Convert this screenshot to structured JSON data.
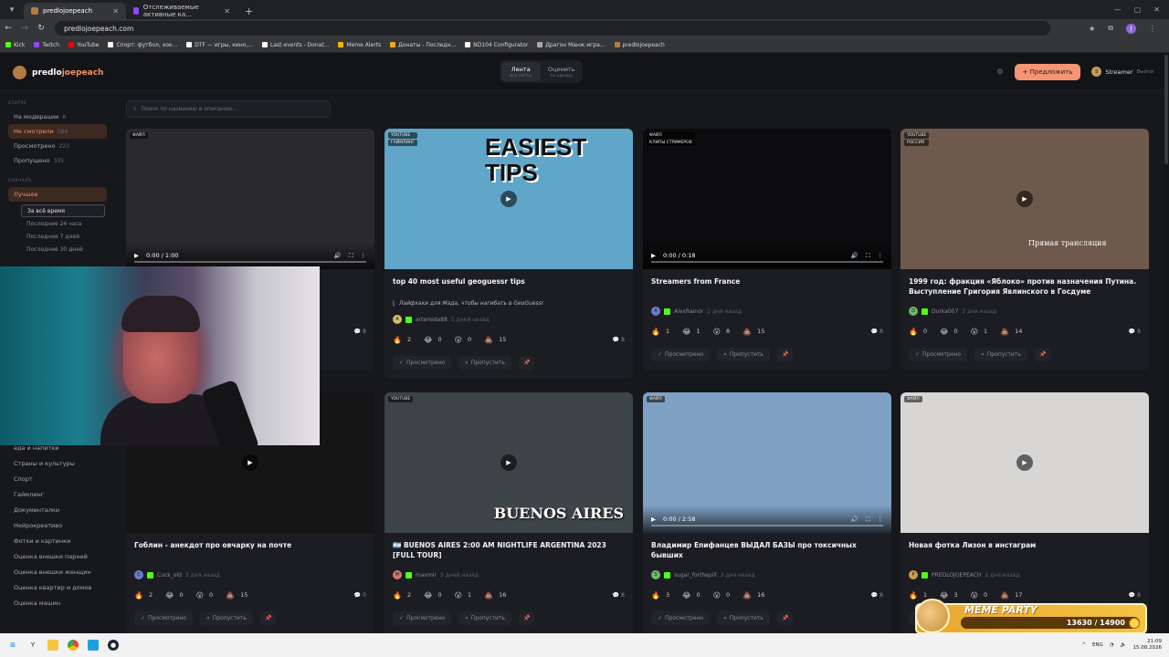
{
  "browser": {
    "tabs": [
      {
        "title": "predlojoepeach",
        "active": true,
        "favicon_color": "#b47a46"
      },
      {
        "title": "Отслеживаемые активные ка...",
        "active": false,
        "favicon_color": "#9146ff"
      }
    ],
    "new_tab": "+",
    "url": "predlojoepeach.com",
    "profile_letter": "J",
    "bookmarks": [
      {
        "label": "Kick",
        "color": "#53fc18"
      },
      {
        "label": "Twitch",
        "color": "#9146ff"
      },
      {
        "label": "YouTube",
        "color": "#ff0000"
      },
      {
        "label": "Спорт: футбол, хок...",
        "color": "#ffffff"
      },
      {
        "label": "DTF — игры, кино,...",
        "color": "#ffffff"
      },
      {
        "label": "Last events - Donat...",
        "color": "#ffffff"
      },
      {
        "label": "Meme Alerts",
        "color": "#f5b400"
      },
      {
        "label": "Донаты - Последн...",
        "color": "#f5a623"
      },
      {
        "label": "ND104 Configurator",
        "color": "#ffffff"
      },
      {
        "label": "Драгон Манж игра...",
        "color": "#aaaaaa"
      },
      {
        "label": "predlojoepeach",
        "color": "#b47a46"
      }
    ]
  },
  "site": {
    "logo_prefix": "predlo",
    "logo_accent": "joepeach",
    "view_tabs": [
      {
        "title": "Лента",
        "sub": "все посты",
        "active": true
      },
      {
        "title": "Оценить",
        "sub": "по одному",
        "active": false
      }
    ],
    "propose_label": "+ Предложить",
    "user_name": "Streamer",
    "user_initial": "S",
    "logout_label": "Выйти",
    "search_placeholder": "Поиск по названию и описанию..."
  },
  "sidebar": {
    "status_title": "СТАТУС",
    "status_items": [
      {
        "label": "На модерации",
        "count": "8",
        "active": false
      },
      {
        "label": "Не смотрели",
        "count": "584",
        "active": true
      },
      {
        "label": "Просмотрено",
        "count": "223",
        "active": false
      },
      {
        "label": "Пропущено",
        "count": "335",
        "active": false
      }
    ],
    "sort_title": "СНАЧАЛА",
    "sort_items": [
      {
        "label": "Лучшее",
        "active": true
      }
    ],
    "period_items": [
      {
        "label": "За всё время",
        "active": true
      },
      {
        "label": "Последние 24 часа",
        "active": false
      },
      {
        "label": "Последние 7 дней",
        "active": false
      },
      {
        "label": "Последние 30 дней",
        "active": false
      }
    ],
    "categories": [
      "еда и напитки",
      "Страны и культуры",
      "Спорт",
      "Гаймлинг",
      "Документалки",
      "Нейрокреативо",
      "Фотки и картинки",
      "Оценка внешки парней",
      "Оценка внешки женщин",
      "Оценка квартир и домов",
      "Оценка машин"
    ]
  },
  "cards": [
    {
      "tags": [
        "файл"
      ],
      "title": "",
      "desc": "",
      "author": "",
      "author_initial": "",
      "author_color": "#6c7bd0",
      "date": "",
      "time": "0:00 / 1:00",
      "has_controls": true,
      "reactions": [
        "",
        "",
        "",
        ""
      ],
      "comments": "8",
      "thumb_bg": "#2a2a2e"
    },
    {
      "tags": [
        "youtube",
        "гаймлинг"
      ],
      "title": "top 40 most useful geoguessr tips",
      "desc": "Лайфхаки для Мада, чтобы нагибать в GeoGuessr",
      "author": "artemida88",
      "author_initial": "A",
      "author_color": "#c9c26a",
      "date": "5 дней назад",
      "time": "",
      "has_controls": false,
      "reactions": [
        "2",
        "0",
        "0",
        "15"
      ],
      "comments": "8",
      "thumb_bg": "#5fa6c9",
      "thumb_text": "EASIEST TIPS"
    },
    {
      "tags": [
        "файл",
        "клипы стримеров"
      ],
      "title": "Streamers from France",
      "desc": "",
      "author": "AlexRainor",
      "author_initial": "A",
      "author_color": "#6c7bd0",
      "date": "2 дня назад",
      "time": "0:00 / 0:18",
      "has_controls": true,
      "reactions": [
        "1",
        "1",
        "8",
        "15"
      ],
      "comments": "8",
      "thumb_bg": "#0c0c0e"
    },
    {
      "tags": [
        "youtube",
        "россия"
      ],
      "title": "1999 год: фракция «Яблоко» против назначения Путина. Выступление Григория Явлинского в Госдуме",
      "desc": "",
      "author": "Durka007",
      "author_initial": "D",
      "author_color": "#6cb96c",
      "date": "2 дня назад",
      "time": "",
      "has_controls": false,
      "reactions": [
        "0",
        "0",
        "1",
        "14"
      ],
      "comments": "8",
      "thumb_bg": "#6e5a4c",
      "thumb_text": "Прямая трансляция"
    },
    {
      "tags": [],
      "title": "Гоблин - анекдот про овчарку на почте",
      "desc": "",
      "author": "Cuck_old",
      "author_initial": "C",
      "author_color": "#6c7bd0",
      "date": "3 дня назад",
      "time": "",
      "has_controls": false,
      "reactions": [
        "2",
        "0",
        "0",
        "15"
      ],
      "comments": "0",
      "thumb_bg": "#151515"
    },
    {
      "tags": [
        "youtube"
      ],
      "title": "🇦🇷 BUENOS AIRES 2:00 AM NIGHTLIFE ARGENTINA 2023 [FULL TOUR]",
      "desc": "",
      "author": "maxmir",
      "author_initial": "M",
      "author_color": "#d07a6c",
      "date": "5 дней назад",
      "time": "",
      "has_controls": false,
      "reactions": [
        "2",
        "0",
        "1",
        "16"
      ],
      "comments": "8",
      "thumb_bg": "#3e4548",
      "thumb_text": "BUENOS AIRES"
    },
    {
      "tags": [
        "файл"
      ],
      "title": "Владимир Епифанцев ВЫДАЛ БАЗЫ про токсичных бывших",
      "desc": "",
      "author": "sugar_forthepill",
      "author_initial": "S",
      "author_color": "#6cb96c",
      "date": "3 дня назад",
      "time": "0:00 / 2:58",
      "has_controls": true,
      "reactions": [
        "3",
        "0",
        "0",
        "16"
      ],
      "comments": "8",
      "thumb_bg": "#7ea0c2"
    },
    {
      "tags": [
        "файл"
      ],
      "title": "Новая фотка Лизон в инстаграм",
      "desc": "",
      "author": "PREDLOJOEPEACH",
      "author_initial": "P",
      "author_color": "#c9a04a",
      "date": "2 дня назад",
      "time": "",
      "has_controls": false,
      "reactions": [
        "1",
        "3",
        "0",
        "17"
      ],
      "comments": "8",
      "thumb_bg": "#d8d6d4"
    }
  ],
  "card_actions": {
    "watched": "Просмотрено",
    "skip": "Пропустить"
  },
  "reaction_icons": [
    "🔥",
    "😂",
    "😮",
    "💩"
  ],
  "overlay": {
    "title": "MEME PARTY",
    "progress": "13630 / 14900",
    "progress_fraction": 0.915
  },
  "taskbar": {
    "lang": "ENG",
    "time": "21:09",
    "date": "15.08.2026"
  }
}
